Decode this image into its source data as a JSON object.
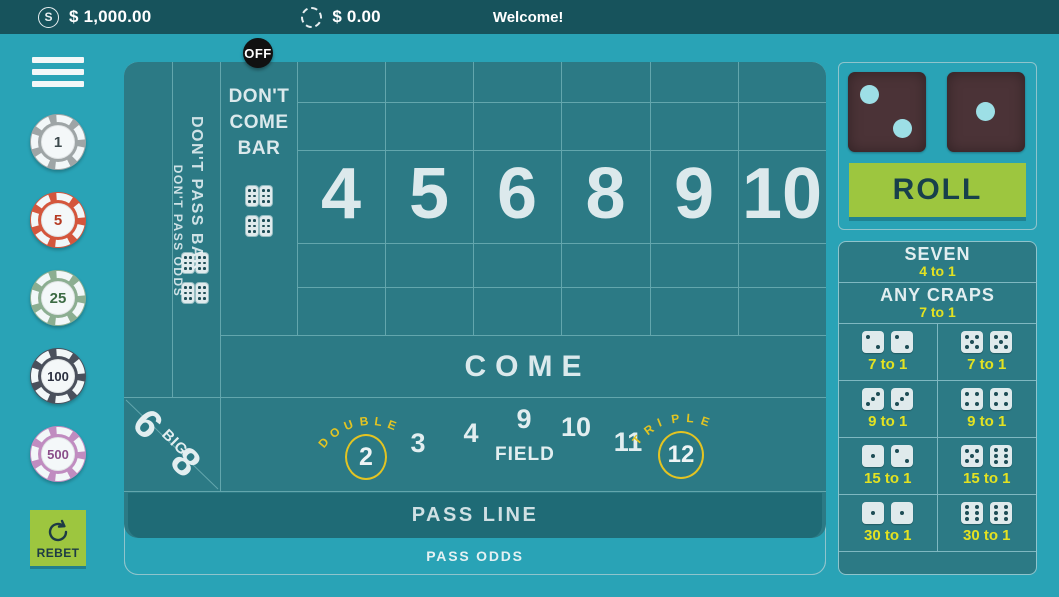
{
  "topbar": {
    "balance_icon": "dollar-circle-icon",
    "balance": "$ 1,000.00",
    "bet_icon": "chip-icon",
    "bet": "$ 0.00",
    "message": "Welcome!"
  },
  "rail": {
    "menu_icon": "hamburger-menu-icon",
    "chips": [
      {
        "value": "1",
        "color": "#9ea5a6",
        "text_color": "#3d4a4d"
      },
      {
        "value": "5",
        "color": "#d4563c",
        "text_color": "#b53a22"
      },
      {
        "value": "25",
        "color": "#8cae91",
        "text_color": "#3c6b44"
      },
      {
        "value": "100",
        "color": "#4a505c",
        "text_color": "#2b3040"
      },
      {
        "value": "500",
        "color": "#c08cc0",
        "text_color": "#8a4d8a"
      }
    ],
    "rebet": {
      "label": "REBET",
      "icon": "rebet-refresh-icon",
      "color": "#9dc63f"
    }
  },
  "table": {
    "puck": "OFF",
    "dont_pass_odds": "DON'T PASS ODDS",
    "dont_pass_bar": "DON'T PASS BAR",
    "dont_come_bar": "DON'T COME BAR",
    "dont_pass_bar_dice": "6-6",
    "dont_come_bar_dice": "6-6",
    "numbers": [
      "4",
      "5",
      "6",
      "8",
      "9",
      "10"
    ],
    "come": "COME",
    "big_6": "6",
    "big_label": "BIG",
    "big_8": "8",
    "field": {
      "label": "FIELD",
      "double_word": "DOUBLE",
      "double_value": "2",
      "numbers": [
        "3",
        "4",
        "9",
        "10",
        "11"
      ],
      "triple_word": "TRIPLE",
      "triple_value": "12"
    },
    "pass_line": "PASS LINE",
    "pass_odds": "PASS ODDS"
  },
  "right": {
    "dice": [
      {
        "name": "left-die",
        "value": 2
      },
      {
        "name": "right-die",
        "value": 1
      }
    ],
    "roll_button": "ROLL",
    "props": {
      "wide": [
        {
          "name": "SEVEN",
          "odds": "4 to 1"
        },
        {
          "name": "ANY CRAPS",
          "odds": "7 to 1"
        }
      ],
      "rows": [
        [
          {
            "bet": "hard-4",
            "dice": [
              2,
              2
            ],
            "odds": "7 to 1"
          },
          {
            "bet": "hard-10",
            "dice": [
              5,
              5
            ],
            "odds": "7 to 1"
          }
        ],
        [
          {
            "bet": "hard-6",
            "dice": [
              3,
              3
            ],
            "odds": "9 to 1"
          },
          {
            "bet": "hard-8",
            "dice": [
              4,
              4
            ],
            "odds": "9 to 1"
          }
        ],
        [
          {
            "bet": "three",
            "dice": [
              1,
              2
            ],
            "odds": "15 to 1"
          },
          {
            "bet": "eleven",
            "dice": [
              5,
              6
            ],
            "odds": "15 to 1"
          }
        ],
        [
          {
            "bet": "two",
            "dice": [
              1,
              1
            ],
            "odds": "30 to 1"
          },
          {
            "bet": "twelve",
            "dice": [
              6,
              6
            ],
            "odds": "30 to 1"
          }
        ]
      ]
    }
  },
  "colors": {
    "felt": "#2c7a85",
    "background": "#29a3b6",
    "topbar": "#17535c",
    "accent_yellow": "#e3e221",
    "accent_green": "#9dc63f",
    "gridline": "#63a6ad"
  }
}
